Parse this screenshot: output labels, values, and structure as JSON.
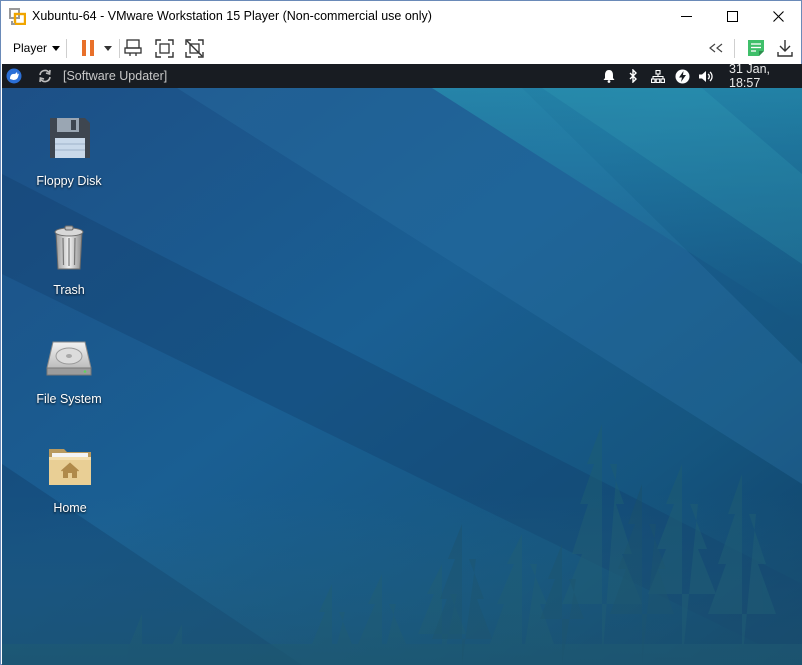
{
  "window": {
    "title": "Xubuntu-64 - VMware Workstation 15 Player (Non-commercial use only)",
    "controls": [
      "minimize-icon",
      "maximize-icon",
      "close-icon"
    ]
  },
  "toolbar": {
    "player_label": "Player",
    "buttons": [
      "pause-icon",
      "send-ctrl-alt-del-icon",
      "fit-guest-icon",
      "unity-icon",
      "back-arrows-icon",
      "notes-icon",
      "download-icon"
    ],
    "accent_color": "#e8702a"
  },
  "panel": {
    "task_label": "[Software Updater]",
    "clock": "31 Jan, 18:57",
    "tray_icons": [
      "bell-icon",
      "bluetooth-icon",
      "network-icon",
      "power-icon",
      "volume-icon"
    ]
  },
  "desktop": {
    "icons": [
      {
        "label": "Floppy Disk",
        "icon": "floppy-disk-icon"
      },
      {
        "label": "Trash",
        "icon": "trash-icon"
      },
      {
        "label": "File System",
        "icon": "hard-drive-icon"
      },
      {
        "label": "Home",
        "icon": "home-folder-icon"
      }
    ]
  }
}
